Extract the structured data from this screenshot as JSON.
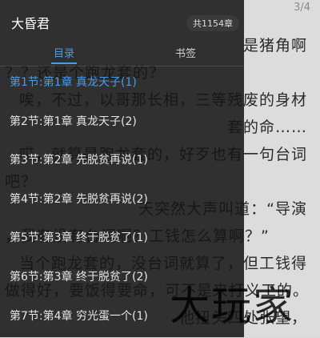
{
  "reader": {
    "page_indicator": "3/4",
    "lines": [
      "是猪角啊",
      "？？还是个跑龙套的？",
      "唉，不过，以哥那长相，三等残废的身材",
      "套的命……",
      "哎，就算是跑龙套的，好歹也有一句台词",
      "吧？",
      "天突然大声叫道：“导演",
      "，我有没有台词啊？工钱怎么算啊？”",
      "当个跑龙套的，没台词就算了，但工钱得",
      "做得好，要饭得要命，可不是来打义工的。",
      "他扭头四处张望，"
    ]
  },
  "drawer": {
    "book_title": "大昏君",
    "chapter_count": "共1154章",
    "tabs": [
      {
        "label": "目录"
      },
      {
        "label": "书签"
      }
    ],
    "chapters": [
      {
        "label": "第1节:第1章 真龙天子(1)"
      },
      {
        "label": "第2节:第1章 真龙天子(2)"
      },
      {
        "label": "第3节:第2章 先脱贫再说(1)"
      },
      {
        "label": "第4节:第2章 先脱贫再说(2)"
      },
      {
        "label": "第5节:第3章 终于脱贫了(1)"
      },
      {
        "label": "第6节:第3章 终于脱贫了(2)"
      },
      {
        "label": "第7节:第4章 穷光蛋一个(1)"
      }
    ]
  },
  "watermark": "大玩家",
  "colors": {
    "accent": "#4a9be8",
    "drawer_bg": "#141414",
    "reader_bg": "#dcdcdc"
  }
}
